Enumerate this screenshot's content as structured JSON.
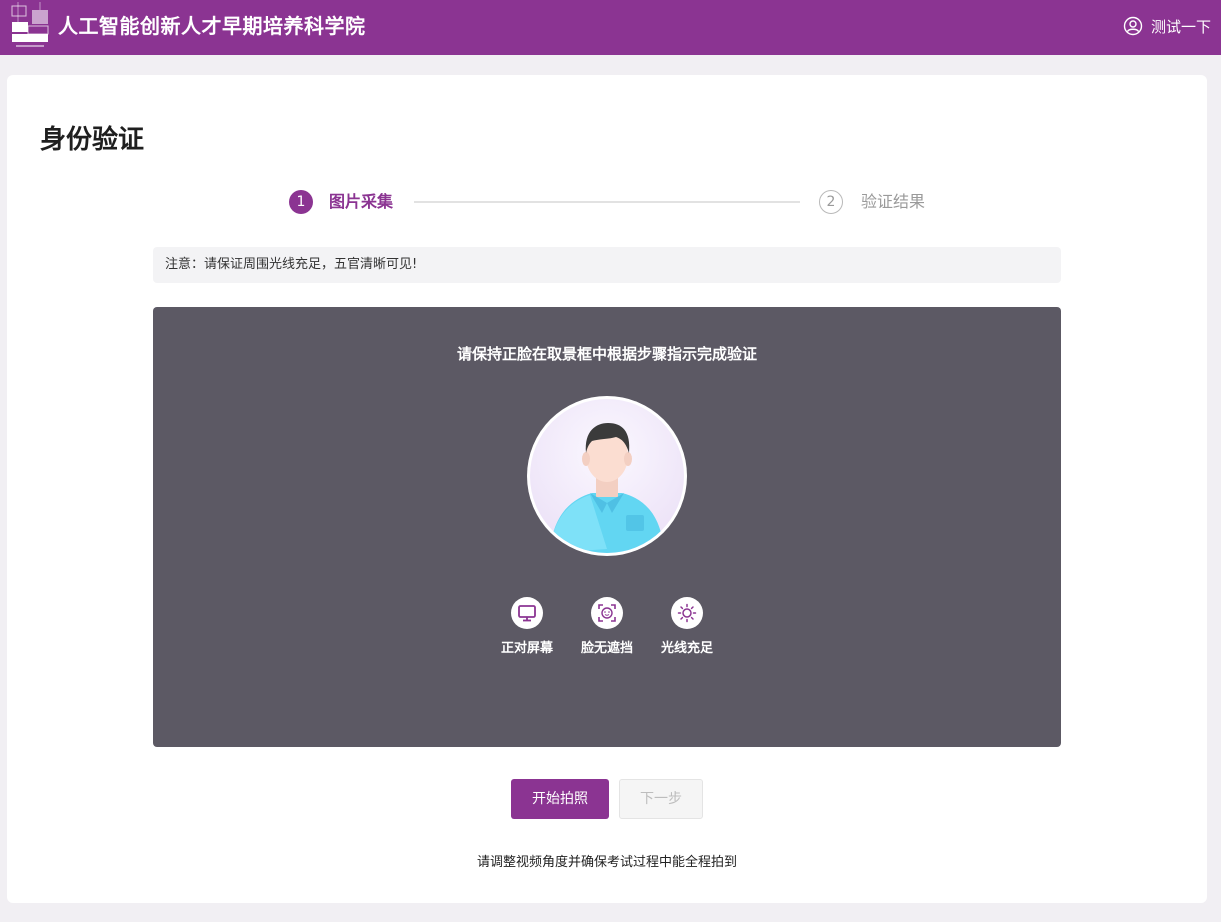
{
  "header": {
    "title": "人工智能创新人才早期培养科学院",
    "user_name": "测试一下",
    "background_color": "#8b3492",
    "logo_icon": "school-logo"
  },
  "page": {
    "title": "身份验证"
  },
  "steps": [
    {
      "number": "1",
      "label": "图片采集",
      "state": "active"
    },
    {
      "number": "2",
      "label": "验证结果",
      "state": "pending"
    }
  ],
  "notice": "注意：请保证周围光线充足，五官清晰可见!",
  "camera": {
    "instruction": "请保持正脸在取景框中根据步骤指示完成验证",
    "tips": [
      {
        "label": "正对屏幕",
        "icon": "monitor-icon"
      },
      {
        "label": "脸无遮挡",
        "icon": "face-scan-icon"
      },
      {
        "label": "光线充足",
        "icon": "sun-icon"
      }
    ]
  },
  "actions": {
    "start_label": "开始拍照",
    "next_label": "下一步",
    "next_disabled": true
  },
  "footer_text": "请调整视频角度并确保考试过程中能全程拍到",
  "colors": {
    "accent": "#8b3492",
    "panel": "#5c5964"
  }
}
